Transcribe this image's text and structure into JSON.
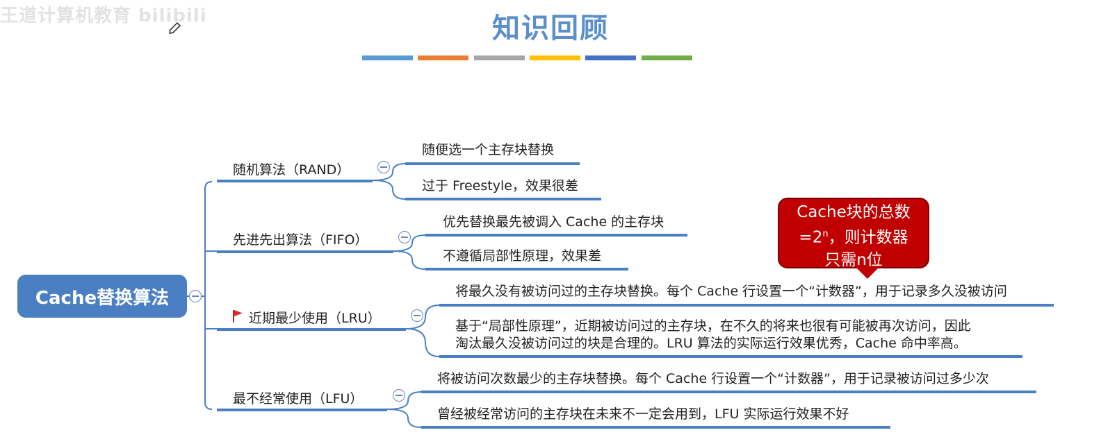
{
  "watermark": "王道计算机教育 bilibili",
  "title": "知识回顾",
  "title_bar_colors": [
    "#5b9bd5",
    "#ed7d31",
    "#a5a5a5",
    "#ffc000",
    "#4472c4",
    "#70ad47"
  ],
  "branch_color": "#4a7fc4",
  "root": {
    "label": "Cache替换算法"
  },
  "branches": [
    {
      "label": "随机算法（RAND）",
      "leaves": [
        "随便选一个主存块替换",
        "过于 Freestyle，效果很差"
      ]
    },
    {
      "label": "先进先出算法（FIFO）",
      "leaves": [
        "优先替换最先被调入 Cache 的主存块",
        "不遵循局部性原理，效果差"
      ]
    },
    {
      "label": "近期最少使用（LRU）",
      "leaves": [
        "将最久没有被访问过的主存块替换。每个 Cache 行设置一个“计数器”，用于记录多久没被访问",
        "基于“局部性原理”，近期被访问过的主存块，在不久的将来也很有可能被再次访问，因此",
        "淘汰最久没被访问过的块是合理的。LRU 算法的实际运行效果优秀，Cache 命中率高。"
      ]
    },
    {
      "label": "最不经常使用（LFU）",
      "leaves": [
        "将被访问次数最少的主存块替换。每个 Cache 行设置一个“计数器”，用于记录被访问过多少次",
        "曾经被经常访问的主存块在未来不一定会用到，LFU 实际运行效果不好"
      ]
    }
  ],
  "callout": {
    "line1": "Cache块的总数",
    "line2_pre": "=2",
    "line2_sup": "n",
    "line2_post": "，则计数器",
    "line3": "只需n位"
  }
}
